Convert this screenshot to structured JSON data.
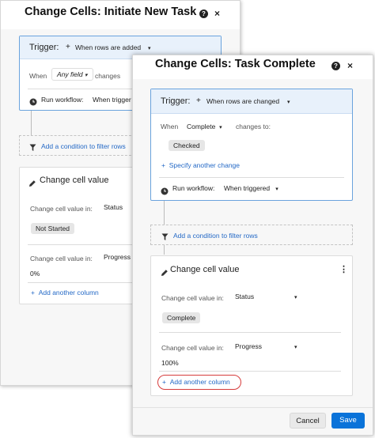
{
  "window1": {
    "title": "Change Cells: Initiate New Task",
    "help_icon": "?",
    "close_icon": "×",
    "trigger": {
      "label": "Trigger:",
      "plus": "+",
      "value": "When rows are added",
      "caret": "▾",
      "when_label": "When",
      "field_value": "Any field",
      "field_caret": "▾",
      "condition_text": "changes",
      "run_label": "Run workflow:",
      "run_value": "When trigger"
    },
    "filter": {
      "label": "Add a condition to filter rows"
    },
    "change_cell": {
      "title": "Change cell value",
      "rows": [
        {
          "label": "Change cell value in:",
          "column": "Status",
          "value": "Not Started"
        },
        {
          "label": "Change cell value in:",
          "column": "Progress",
          "value": "0%"
        }
      ],
      "add_column": "Add another column"
    }
  },
  "window2": {
    "title": "Change Cells: Task Complete",
    "help_icon": "?",
    "close_icon": "×",
    "trigger": {
      "label": "Trigger:",
      "plus": "+",
      "value": "When rows are changed",
      "caret": "▾",
      "when_label": "When",
      "field_value": "Complete",
      "field_caret": "▾",
      "condition_text": "changes to:",
      "checked_value": "Checked",
      "specify_change": "Specify another change",
      "run_label": "Run workflow:",
      "run_value": "When triggered",
      "run_caret": "▾"
    },
    "filter": {
      "label": "Add a condition to filter rows"
    },
    "change_cell": {
      "title": "Change cell value",
      "more_icon": "⋮",
      "rows": [
        {
          "label": "Change cell value in:",
          "column": "Status",
          "caret": "▾",
          "value": "Complete"
        },
        {
          "label": "Change cell value in:",
          "column": "Progress",
          "caret": "▾",
          "value": "100%"
        }
      ],
      "add_column": "Add another column"
    },
    "footer": {
      "cancel": "Cancel",
      "save": "Save"
    }
  },
  "colors": {
    "accent": "#0a73d9",
    "link": "#2469c6",
    "trigger_border": "#6aa3dd",
    "highlight": "#d63b3b"
  }
}
